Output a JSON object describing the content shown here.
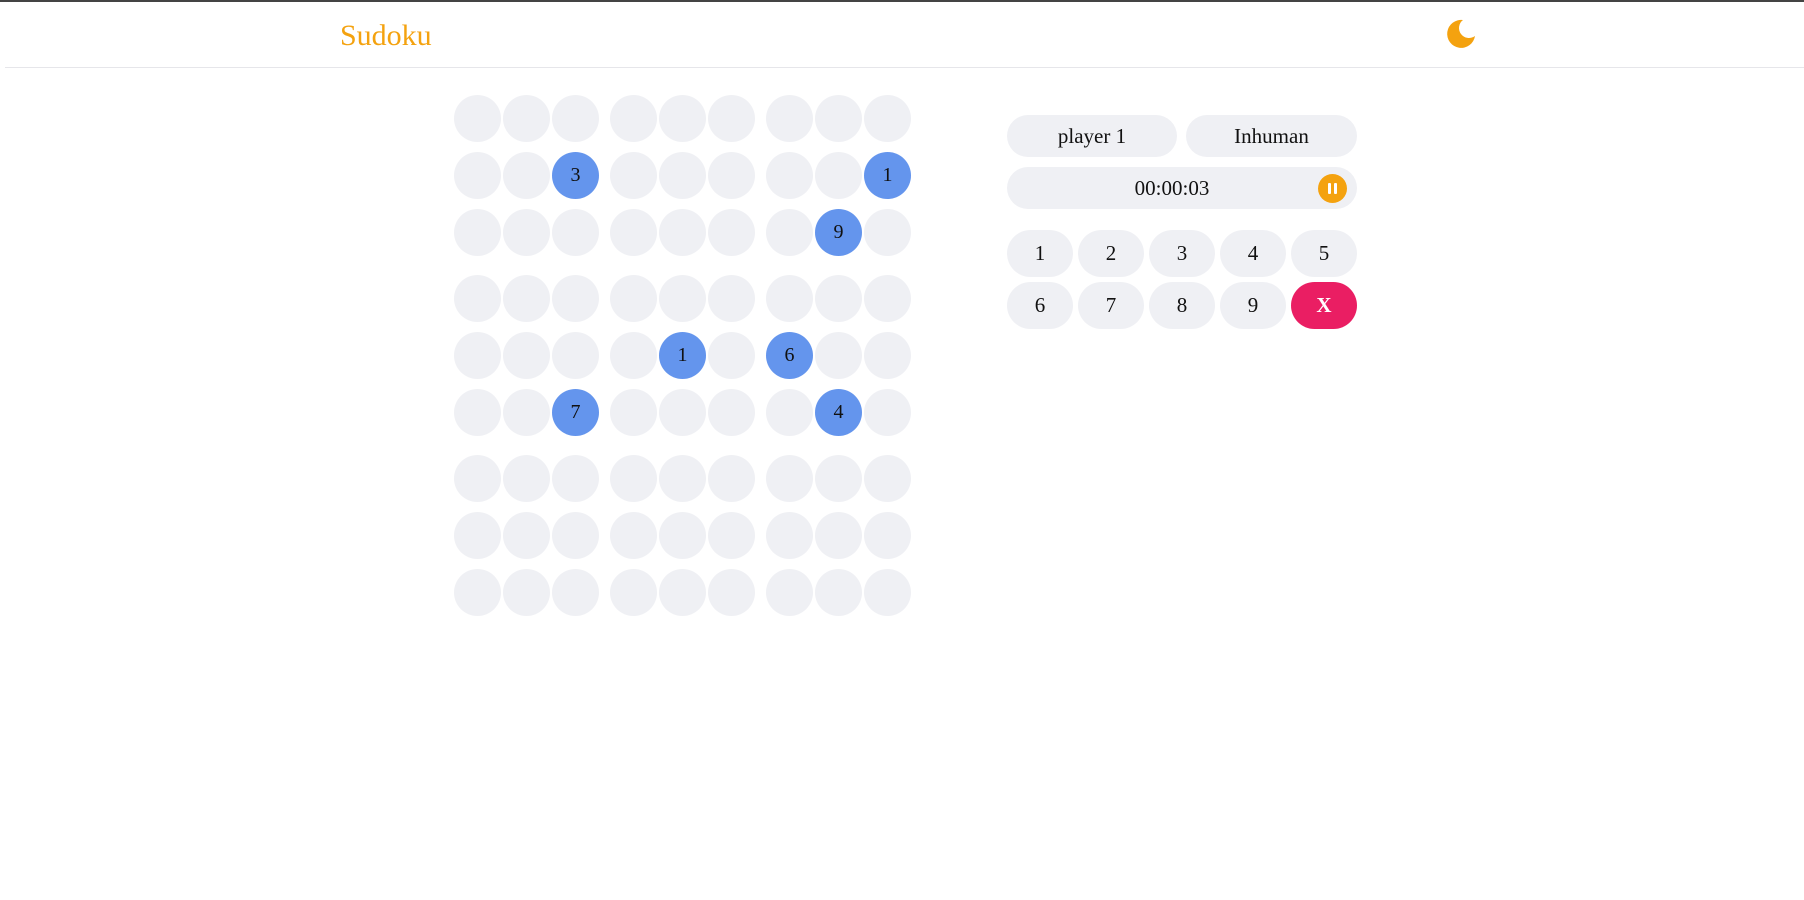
{
  "app": {
    "title": "Sudoku"
  },
  "theme": {
    "icon": "moon-icon",
    "accent_color": "#f4a20f",
    "given_cell_color": "#6495ed",
    "empty_cell_color": "#eff0f4",
    "erase_color": "#ea1e63"
  },
  "board": {
    "rows": [
      [
        "",
        "",
        "",
        "",
        "",
        "",
        "",
        "",
        ""
      ],
      [
        "",
        "",
        "3",
        "",
        "",
        "",
        "",
        "",
        "1"
      ],
      [
        "",
        "",
        "",
        "",
        "",
        "",
        "",
        "9",
        ""
      ],
      [
        "",
        "",
        "",
        "",
        "",
        "",
        "",
        "",
        ""
      ],
      [
        "",
        "",
        "",
        "",
        "1",
        "",
        "6",
        "",
        ""
      ],
      [
        "",
        "",
        "7",
        "",
        "",
        "",
        "",
        "4",
        ""
      ],
      [
        "",
        "",
        "",
        "",
        "",
        "",
        "",
        "",
        ""
      ],
      [
        "",
        "",
        "",
        "",
        "",
        "",
        "",
        "",
        ""
      ],
      [
        "",
        "",
        "",
        "",
        "",
        "",
        "",
        "",
        ""
      ]
    ]
  },
  "game": {
    "player_name": "player 1",
    "difficulty": "Inhuman",
    "timer": "00:00:03",
    "pause_icon": "pause-icon"
  },
  "numpad": {
    "keys": [
      "1",
      "2",
      "3",
      "4",
      "5",
      "6",
      "7",
      "8",
      "9"
    ],
    "erase_label": "X"
  }
}
